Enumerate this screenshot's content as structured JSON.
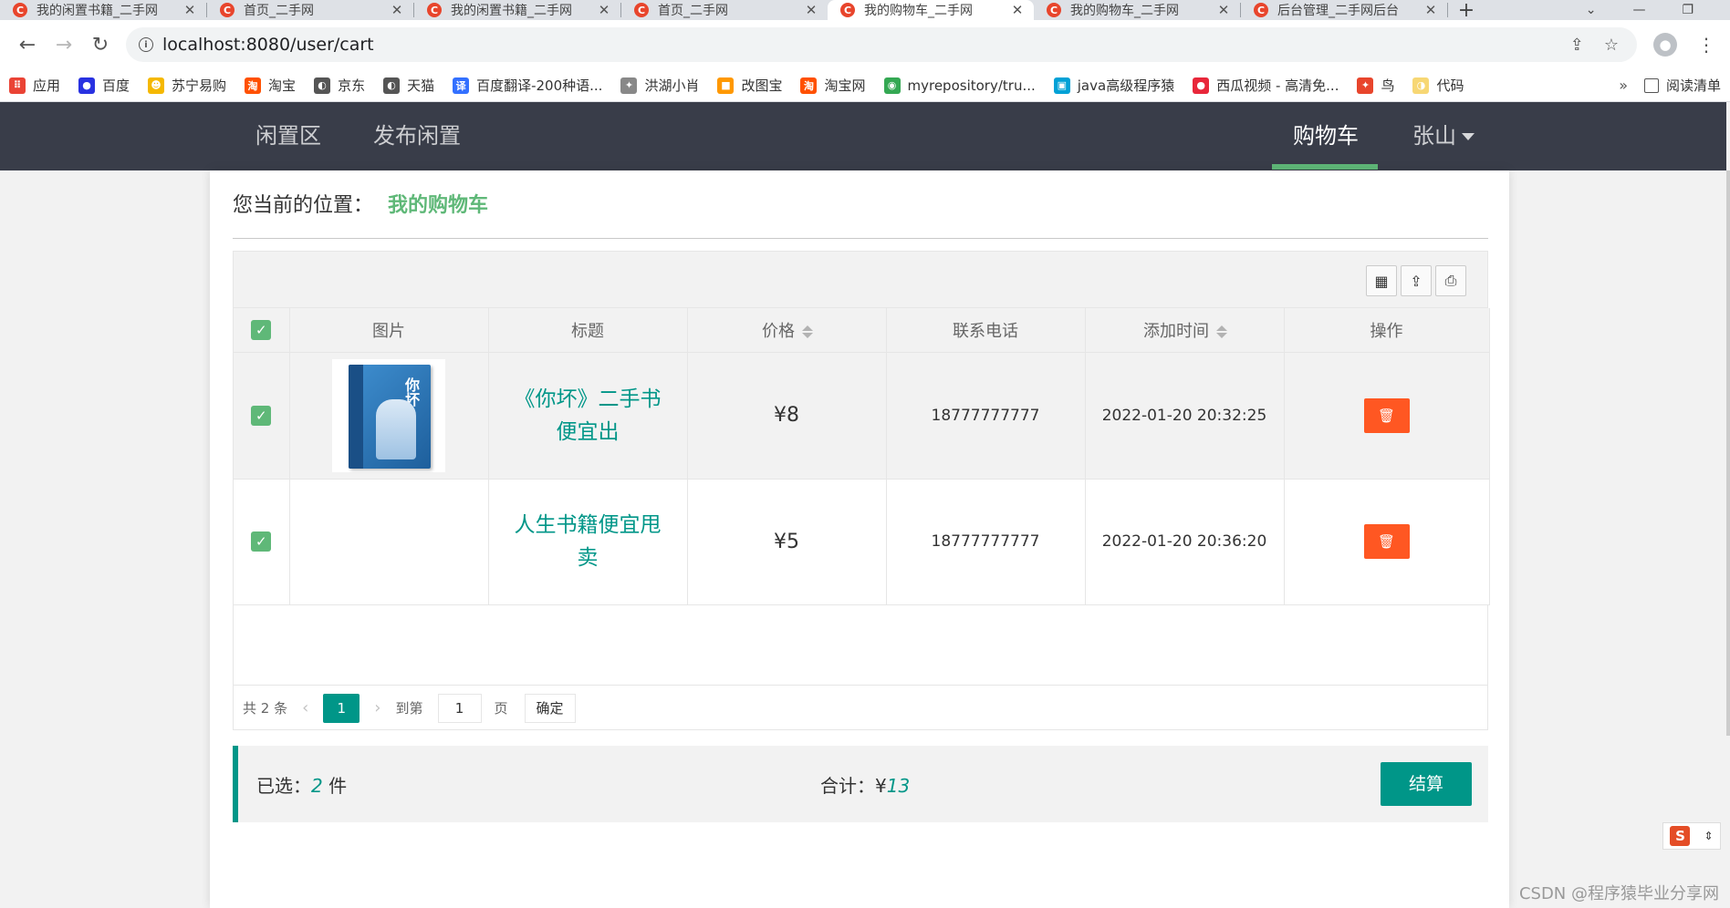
{
  "browser": {
    "tabs": [
      {
        "title": "我的闲置书籍_二手网",
        "active": false
      },
      {
        "title": "首页_二手网",
        "active": false
      },
      {
        "title": "我的闲置书籍_二手网",
        "active": false
      },
      {
        "title": "首页_二手网",
        "active": false
      },
      {
        "title": "我的购物车_二手网",
        "active": true
      },
      {
        "title": "我的购物车_二手网",
        "active": false
      },
      {
        "title": "后台管理_二手网后台",
        "active": false
      }
    ],
    "tab_close": "✕",
    "new_tab": "+",
    "url": "localhost:8080/user/cart",
    "bookmarks": [
      {
        "label": "应用",
        "icon": "apps-grid-icon",
        "color": "#ea4335"
      },
      {
        "label": "百度",
        "icon": "baidu-icon",
        "color": "#2932e1"
      },
      {
        "label": "苏宁易购",
        "icon": "suning-icon",
        "color": "#f5b800"
      },
      {
        "label": "淘宝",
        "icon": "taobao-icon",
        "color": "#ff5000"
      },
      {
        "label": "京东",
        "icon": "globe-icon",
        "color": "#555555"
      },
      {
        "label": "天猫",
        "icon": "globe-icon",
        "color": "#555555"
      },
      {
        "label": "百度翻译-200种语...",
        "icon": "translate-icon",
        "color": "#3370ff"
      },
      {
        "label": "洪湖小肖",
        "icon": "bird-icon",
        "color": "#888888"
      },
      {
        "label": "改图宝",
        "icon": "gaitubao-icon",
        "color": "#ff9800"
      },
      {
        "label": "淘宝网",
        "icon": "taobao-icon",
        "color": "#ff5000"
      },
      {
        "label": "myrepository/tru...",
        "icon": "chrome-icon",
        "color": "#34a853"
      },
      {
        "label": "java高级程序猿",
        "icon": "bilibili-icon",
        "color": "#00a1d6"
      },
      {
        "label": "西瓜视频 - 高清免...",
        "icon": "xigua-icon",
        "color": "#e8273a"
      },
      {
        "label": "鸟",
        "icon": "bird-icon",
        "color": "#e8452c"
      },
      {
        "label": "代码",
        "icon": "code-icon",
        "color": "#f7d774"
      }
    ],
    "bookmarks_more": "»",
    "reading_list": "阅读清单"
  },
  "site": {
    "nav_left": [
      "闲置区",
      "发布闲置"
    ],
    "nav_cart": "购物车",
    "nav_user": "张山"
  },
  "breadcrumb": {
    "prefix": "您当前的位置：",
    "current": "我的购物车"
  },
  "table": {
    "headers": [
      "图片",
      "标题",
      "价格",
      "联系电话",
      "添加时间",
      "操作"
    ],
    "rows": [
      {
        "title_line1": "《你坏》二手书",
        "title_line2": "便宜出",
        "price": "¥8",
        "phone": "18777777777",
        "time": "2022-01-20 20:32:25",
        "has_image": true,
        "cover_text": "你坏"
      },
      {
        "title_line1": "人生书籍便宜甩",
        "title_line2": "卖",
        "price": "¥5",
        "phone": "18777777777",
        "time": "2022-01-20 20:36:20",
        "has_image": false
      }
    ]
  },
  "pager": {
    "total": "共 2 条",
    "current_page": "1",
    "goto_label": "到第",
    "goto_value": "1",
    "page_label": "页",
    "ok_label": "确定"
  },
  "summary": {
    "selected_label": "已选：",
    "selected_count": "2",
    "selected_unit": " 件",
    "total_label": "合计：",
    "currency": "¥",
    "total_value": "13",
    "checkout_label": "结算"
  },
  "watermark": "CSDN @程序猿毕业分享网",
  "colors": {
    "nav_bg": "#393d49",
    "accent_green": "#5fb878",
    "teal": "#009688",
    "danger": "#ff5722"
  }
}
